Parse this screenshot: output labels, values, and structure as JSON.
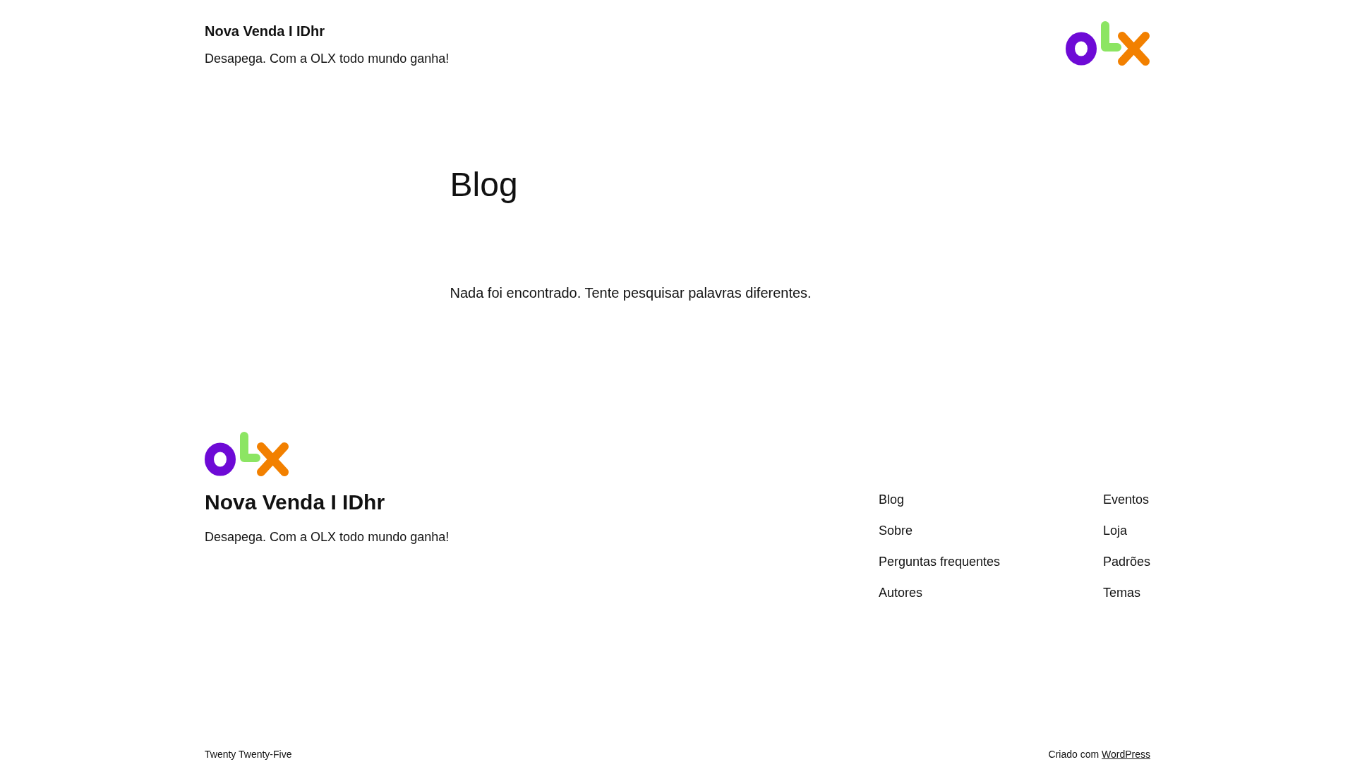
{
  "header": {
    "site_title": "Nova Venda I IDhr",
    "tagline": "Desapega. Com a OLX todo mundo ganha!"
  },
  "main": {
    "title": "Blog",
    "message": "Nada foi encontrado. Tente pesquisar palavras diferentes."
  },
  "footer": {
    "site_title": "Nova Venda I IDhr",
    "tagline": "Desapega. Com a OLX todo mundo ganha!",
    "nav_columns": [
      [
        "Blog",
        "Sobre",
        "Perguntas frequentes",
        "Autores"
      ],
      [
        "Eventos",
        "Loja",
        "Padrões",
        "Temas"
      ]
    ],
    "theme_credit": "Twenty Twenty-Five",
    "credit": {
      "text": "Criado com",
      "link": "WordPress"
    }
  }
}
